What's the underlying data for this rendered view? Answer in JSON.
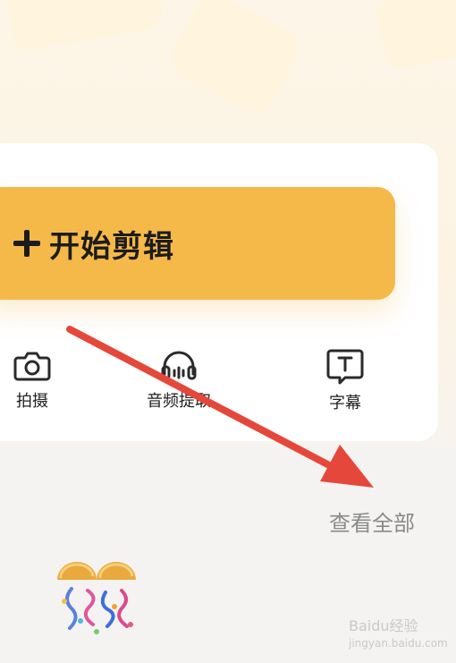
{
  "primary_action": {
    "label": "开始剪辑"
  },
  "tools": [
    {
      "label": "拍摄",
      "icon": "camera-icon"
    },
    {
      "label": "音频提取",
      "icon": "headphones-icon"
    },
    {
      "label": "字幕",
      "icon": "subtitle-icon"
    }
  ],
  "view_all": {
    "label": "查看全部"
  },
  "watermark": {
    "text": "Baidu经验",
    "subtext": "jingyan.baidu.com"
  },
  "colors": {
    "accent": "#f5b94a",
    "annotation": "#e5483a"
  }
}
